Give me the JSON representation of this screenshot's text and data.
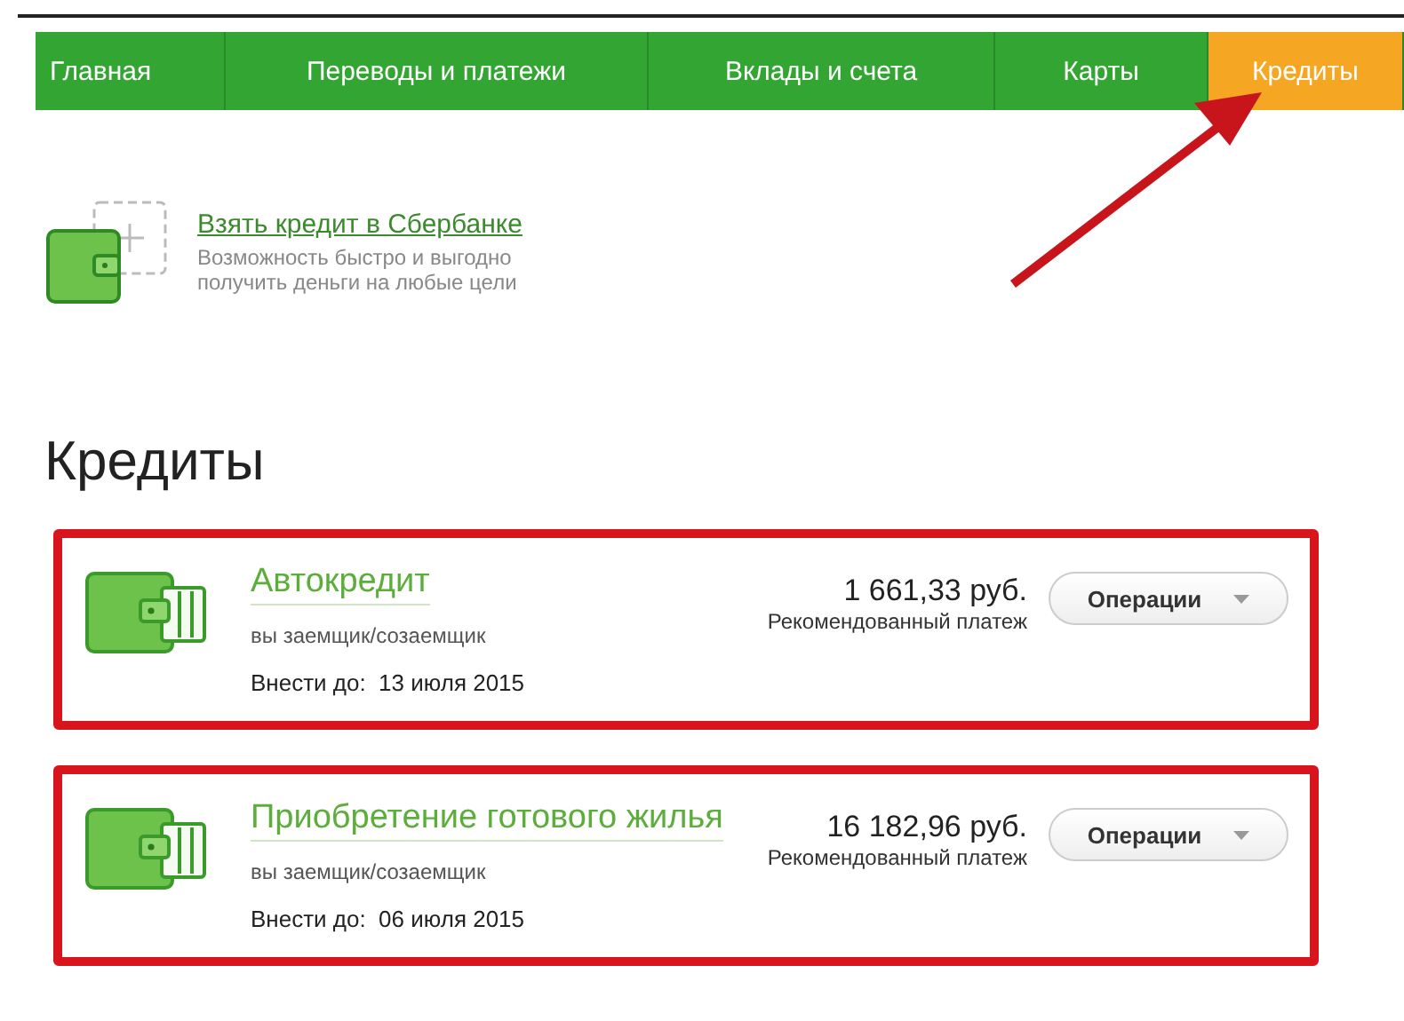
{
  "nav": {
    "tabs": [
      {
        "label": "Главная",
        "selected": false
      },
      {
        "label": "Переводы и платежи",
        "selected": false
      },
      {
        "label": "Вклады и счета",
        "selected": false
      },
      {
        "label": "Карты",
        "selected": false
      },
      {
        "label": "Кредиты",
        "selected": true
      }
    ]
  },
  "offer": {
    "title": "Взять кредит в Сбербанке",
    "description": "Возможность быстро и выгодно получить деньги на любые цели"
  },
  "heading": "Кредиты",
  "loans": [
    {
      "name": "Автокредит",
      "role": "вы заемщик/созаемщик",
      "amount": "1 661,33 руб.",
      "amount_caption": "Рекомендованный платеж",
      "due_label": "Внести до:",
      "due_date": "13 июля 2015",
      "button": "Операции"
    },
    {
      "name": "Приобретение готового жилья",
      "role": "вы заемщик/созаемщик",
      "amount": "16 182,96 руб.",
      "amount_caption": "Рекомендованный платеж",
      "due_label": "Внести до:",
      "due_date": "06 июля 2015",
      "button": "Операции"
    }
  ]
}
